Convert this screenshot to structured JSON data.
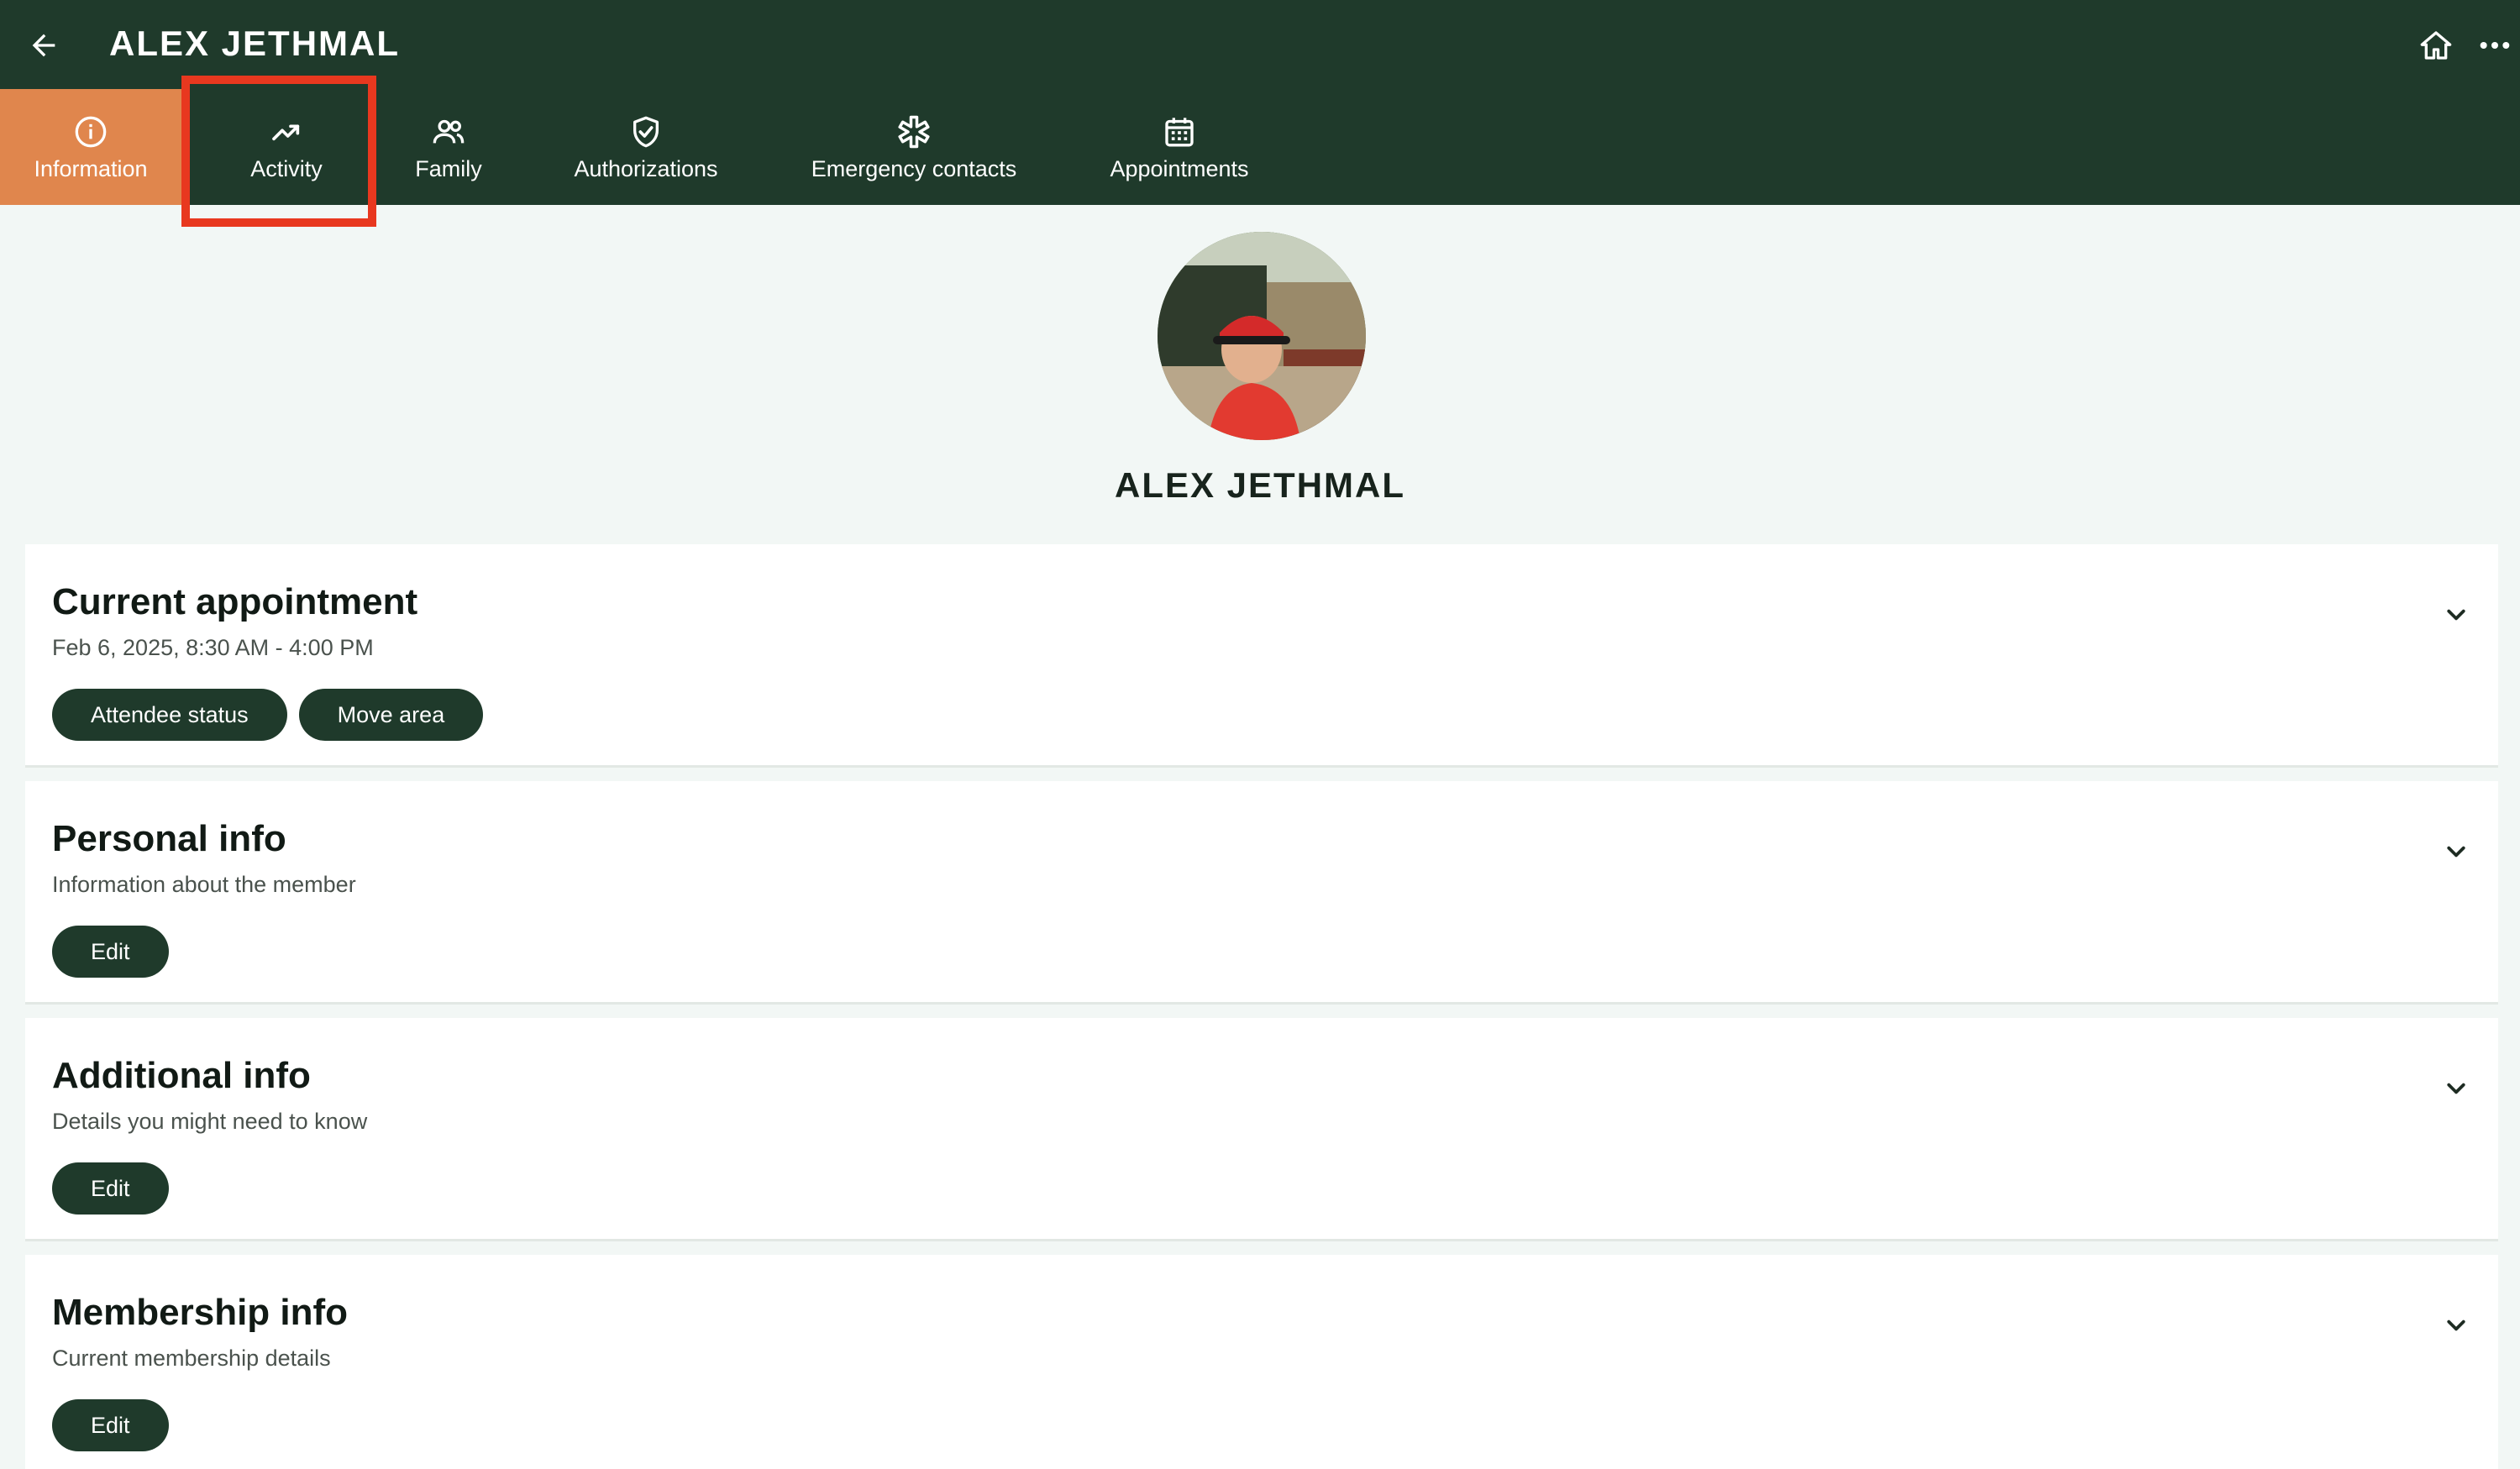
{
  "header": {
    "title": "ALEX JETHMAL",
    "back_icon": "arrow-left-icon",
    "home_icon": "home-icon",
    "more_icon": "more-horizontal-icon"
  },
  "tabs": [
    {
      "label": "Information",
      "icon": "info-icon",
      "active": true
    },
    {
      "label": "Activity",
      "icon": "trending-up-icon",
      "active": false
    },
    {
      "label": "Family",
      "icon": "people-icon",
      "active": false
    },
    {
      "label": "Authorizations",
      "icon": "shield-check-icon",
      "active": false
    },
    {
      "label": "Emergency contacts",
      "icon": "medical-star-icon",
      "active": false
    },
    {
      "label": "Appointments",
      "icon": "calendar-icon",
      "active": false
    }
  ],
  "profile": {
    "name": "ALEX JETHMAL"
  },
  "cards": {
    "current_appointment": {
      "title": "Current appointment",
      "subtitle": "Feb 6, 2025, 8:30 AM - 4:00 PM",
      "buttons": [
        "Attendee status",
        "Move area"
      ]
    },
    "personal_info": {
      "title": "Personal info",
      "subtitle": "Information about the member",
      "button": "Edit"
    },
    "additional_info": {
      "title": "Additional info",
      "subtitle": "Details you might need to know",
      "button": "Edit"
    },
    "membership_info": {
      "title": "Membership info",
      "subtitle": "Current membership details",
      "button": "Edit"
    }
  },
  "colors": {
    "header_bg": "#1f3a2b",
    "active_tab": "#e0864d",
    "highlight": "#e8381f",
    "page_bg": "#f2f7f5"
  }
}
